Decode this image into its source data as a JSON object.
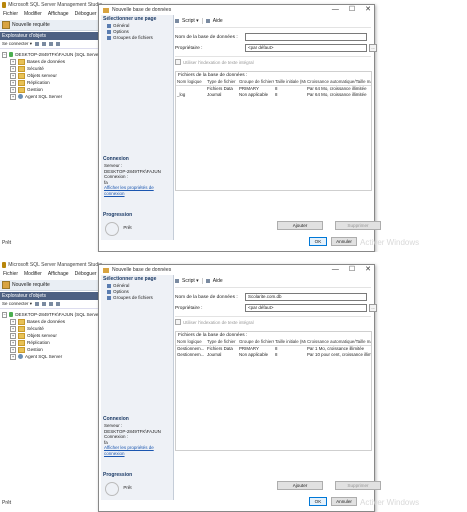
{
  "screens": [
    {
      "ssms": {
        "window_title": "Microsoft SQL Server Management Studio",
        "menu": [
          "Fichier",
          "Modifier",
          "Affichage",
          "Déboguer"
        ],
        "toolbar_new_query": "Nouvelle requête",
        "object_explorer": {
          "header": "Explorateur d'objets",
          "connect": "Se connecter ▾",
          "tree": {
            "server": "DESKTOP-2849TFK\\FAJUN (SQL Server",
            "children": [
              "Bases de données",
              "Sécurité",
              "Objets serveur",
              "Réplication",
              "Gestion",
              "Agent SQL Server"
            ]
          }
        },
        "status": "Prêt"
      },
      "dialog": {
        "title": "Nouvelle base de données",
        "window_buttons": {
          "minimize": "—",
          "maximize": "☐",
          "close": "✕"
        },
        "select_page": "Sélectionner une page",
        "pages": [
          "Général",
          "Options",
          "Groupes de fichiers"
        ],
        "toolbar": {
          "script": "Script ▾",
          "help": "Aide"
        },
        "db_name_label": "Nom de la base de données :",
        "db_name_value": "",
        "owner_label": "Propriétaire :",
        "owner_value": "<par défaut>",
        "browse_label": "...",
        "fulltext_label": "Utiliser l'indexation de texte intégral",
        "files_title": "Fichiers de la base de données :",
        "columns": [
          "Nom logique",
          "Type de fichier",
          "Groupe de fichiers",
          "Taille initiale (Mo)",
          "Croissance automatique/Taille maximale"
        ],
        "rows": [
          [
            "",
            "Fichiers Data",
            "PRIMARY",
            "8",
            "Par 64 Mo, croissance illimitée"
          ],
          [
            "_log",
            "Journal",
            "Non applicable",
            "8",
            "Par 64 Mo, croissance illimitée"
          ]
        ],
        "connection": {
          "header": "Connexion",
          "server_label": "Serveur :",
          "server_value": "DESKTOP-2849TFK\\FAJUN",
          "conn_label": "Connexion :",
          "conn_value": "fa",
          "link": "Afficher les propriétés de connexion"
        },
        "progress": {
          "header": "Progression",
          "status": "Prêt"
        },
        "add_button": "Ajouter",
        "remove_button": "Supprimer",
        "ok_button": "OK",
        "cancel_button": "Annuler"
      },
      "watermark": "Activer Windows"
    },
    {
      "ssms": {
        "window_title": "Microsoft SQL Server Management Studio",
        "menu": [
          "Fichier",
          "Modifier",
          "Affichage",
          "Déboguer"
        ],
        "toolbar_new_query": "Nouvelle requête",
        "object_explorer": {
          "header": "Explorateur d'objets",
          "connect": "Se connecter ▾",
          "tree": {
            "server": "DESKTOP-2849TFK\\FAJUN (SQL Server",
            "children": [
              "Bases de données",
              "Sécurité",
              "Objets serveur",
              "Réplication",
              "Gestion",
              "Agent SQL Server"
            ]
          }
        },
        "status": "Prêt"
      },
      "dialog": {
        "title": "Nouvelle base de données",
        "window_buttons": {
          "minimize": "—",
          "maximize": "☐",
          "close": "✕"
        },
        "select_page": "Sélectionner une page",
        "pages": [
          "Général",
          "Options",
          "Groupes de fichiers"
        ],
        "toolbar": {
          "script": "Script ▾",
          "help": "Aide"
        },
        "db_name_label": "Nom de la base de données :",
        "db_name_value": "Scolarite.com.db",
        "owner_label": "Propriétaire :",
        "owner_value": "<par défaut>",
        "browse_label": "...",
        "fulltext_label": "Utiliser l'indexation de texte intégral",
        "files_title": "Fichiers de la base de données :",
        "columns": [
          "Nom logique",
          "Type de fichier",
          "Groupe de fichiers",
          "Taille initiale (Mo)",
          "Croissance automatique/Taille maximale"
        ],
        "rows": [
          [
            "Gestionnem...",
            "Fichiers Data",
            "PRIMARY",
            "8",
            "Par 1 Mo, croissance illimitée"
          ],
          [
            "Gestionnem...",
            "Journal",
            "Non applicable",
            "8",
            "Par 10 pour cent, croissance illimitée"
          ]
        ],
        "connection": {
          "header": "Connexion",
          "server_label": "Serveur :",
          "server_value": "DESKTOP-2849TFK\\FAJUN",
          "conn_label": "Connexion :",
          "conn_value": "fa",
          "link": "Afficher les propriétés de connexion"
        },
        "progress": {
          "header": "Progression",
          "status": "Prêt"
        },
        "add_button": "Ajouter",
        "remove_button": "Supprimer",
        "ok_button": "OK",
        "cancel_button": "Annuler"
      },
      "watermark": "Activer Windows"
    }
  ]
}
